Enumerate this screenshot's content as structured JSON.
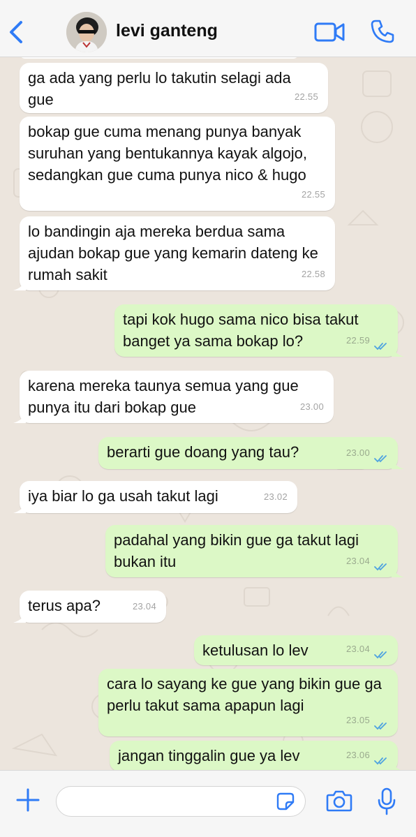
{
  "header": {
    "contact_name": "levi ganteng",
    "back_icon": "chevron-left-icon",
    "video_icon": "video-camera-icon",
    "phone_icon": "phone-icon",
    "accent_color": "#2f7bf6"
  },
  "messages": [
    {
      "direction": "in",
      "text": "ga ada yang perlu lo takutin selagi ada gue",
      "time": "22.55"
    },
    {
      "direction": "in",
      "text": "bokap gue cuma menang punya banyak suruhan yang bentukannya kayak algojo, sedangkan gue cuma punya nico & hugo",
      "time": "22.55"
    },
    {
      "direction": "in",
      "text": "lo bandingin aja mereka berdua sama ajudan bokap gue yang kemarin dateng ke rumah sakit",
      "time": "22.58"
    },
    {
      "direction": "out",
      "text": "tapi kok hugo sama nico bisa takut banget ya sama bokap lo?",
      "time": "22.59",
      "read": true
    },
    {
      "direction": "in",
      "text": "karena mereka taunya semua yang gue punya itu dari bokap gue",
      "time": "23.00"
    },
    {
      "direction": "out",
      "text": "berarti gue doang yang tau?",
      "time": "23.00",
      "read": true
    },
    {
      "direction": "in",
      "text": "iya biar lo ga usah takut lagi",
      "time": "23.02"
    },
    {
      "direction": "out",
      "text": "padahal yang bikin gue ga takut lagi bukan itu",
      "time": "23.04",
      "read": true
    },
    {
      "direction": "in",
      "text": "terus apa?",
      "time": "23.04"
    },
    {
      "direction": "out",
      "text": "ketulusan lo lev",
      "time": "23.04",
      "read": true
    },
    {
      "direction": "out",
      "text": "cara lo sayang ke gue yang bikin gue ga perlu takut sama apapun lagi",
      "time": "23.05",
      "read": true
    },
    {
      "direction": "out",
      "text": "jangan tinggalin gue ya lev",
      "time": "23.06",
      "read": true
    }
  ],
  "footer": {
    "input_value": "",
    "plus_icon": "plus-icon",
    "sticker_icon": "sticker-icon",
    "camera_icon": "camera-icon",
    "mic_icon": "microphone-icon"
  },
  "colors": {
    "incoming_bubble": "#ffffff",
    "outgoing_bubble": "#dcf8c6",
    "chat_background": "#ece5dd",
    "read_ticks": "#4fa3e0"
  }
}
